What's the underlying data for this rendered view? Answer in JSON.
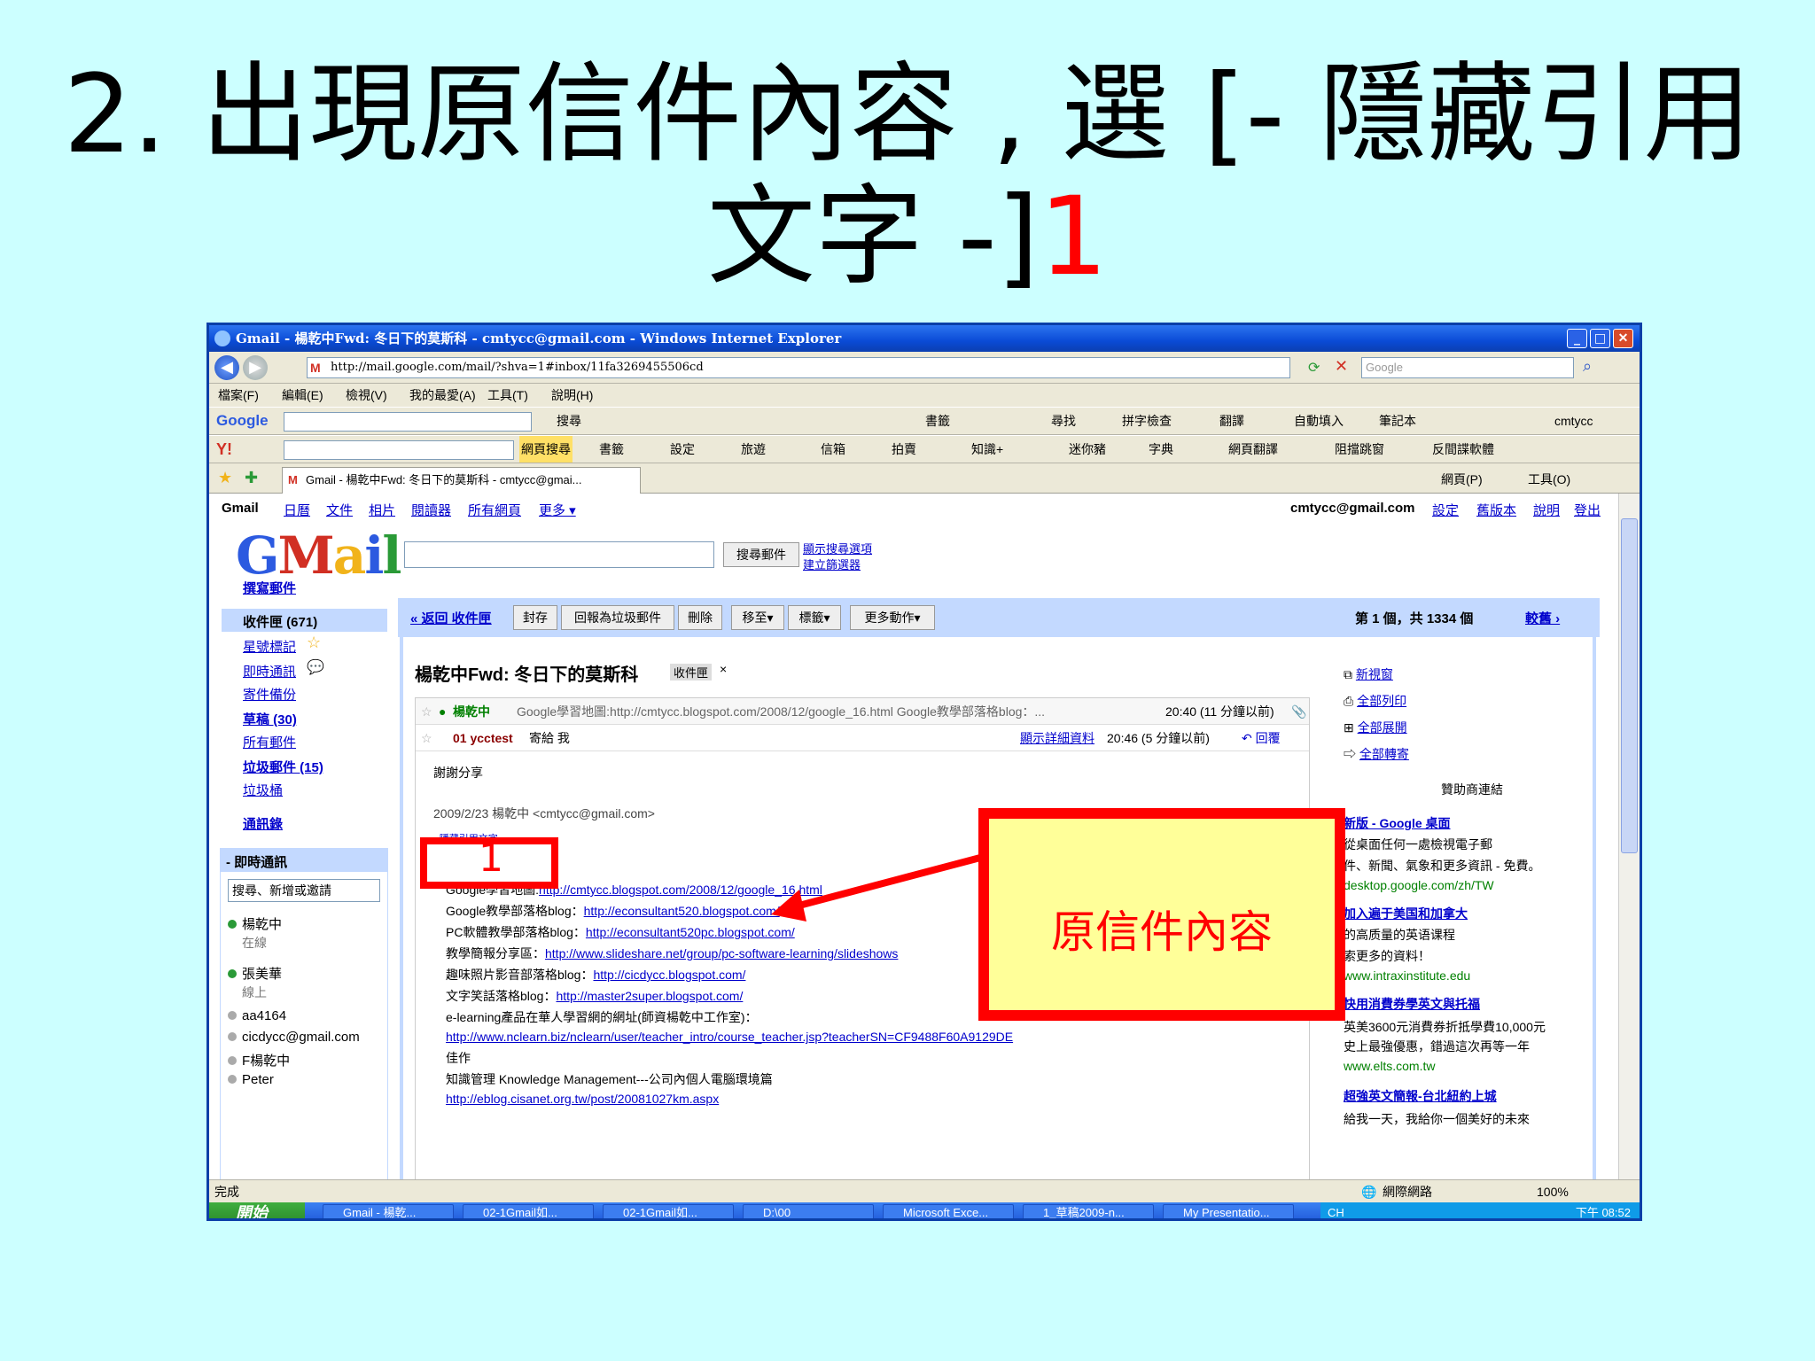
{
  "slide": {
    "title_line1": "2. 出現原信件內容 , 選 [-  隱藏引用",
    "title_line2_black": "文字  -]",
    "title_line2_red": "1",
    "callout_text": "原信件內容",
    "mark_number": "1"
  },
  "browser": {
    "window_title": "Gmail - 楊乾中Fwd: 冬日下的莫斯科 - cmtycc@gmail.com - Windows Internet Explorer",
    "address": "http://mail.google.com/mail/?shva=1#inbox/11fa3269455506cd",
    "search_placeholder": "Google",
    "menu": [
      "檔案(F)",
      "編輯(E)",
      "檢視(V)",
      "我的最愛(A)",
      "工具(T)",
      "說明(H)"
    ],
    "google_toolbar": [
      "Google",
      "搜尋",
      "書籤",
      "尋找",
      "拼字檢查",
      "翻譯",
      "自動填入",
      "筆記本",
      "cmtycc"
    ],
    "yahoo_toolbar": [
      "網頁搜尋",
      "書籤",
      "設定",
      "旅遊",
      "信箱",
      "拍賣",
      "知識+",
      "迷你豬",
      "字典",
      "網頁翻譯",
      "阻擋跳窗",
      "反間諜軟體"
    ],
    "tab_title": "Gmail - 楊乾中Fwd: 冬日下的莫斯科 - cmtycc@gmai...",
    "tab_tools": [
      "網頁(P)",
      "工具(O)"
    ],
    "status": "完成",
    "status_zone": "網際網路",
    "zoom": "100%"
  },
  "gmail": {
    "topnav": [
      "Gmail",
      "日曆",
      "文件",
      "相片",
      "閱讀器",
      "所有網頁",
      "更多 ▾"
    ],
    "account": "cmtycc@gmail.com",
    "account_links": [
      "設定",
      "舊版本",
      "說明",
      "登出"
    ],
    "search_button": "搜尋郵件",
    "search_options": [
      "顯示搜尋選項",
      "建立篩選器"
    ],
    "compose": "撰寫郵件",
    "nav": [
      {
        "label": "收件匣 (671)"
      },
      {
        "label": "星號標記"
      },
      {
        "label": "即時通訊"
      },
      {
        "label": "寄件備份"
      },
      {
        "label": "草稿 (30)"
      },
      {
        "label": "所有郵件"
      },
      {
        "label": "垃圾郵件 (15)"
      },
      {
        "label": "垃圾桶"
      },
      {
        "label": "通訊錄"
      }
    ],
    "chat": {
      "header": "- 即時通訊",
      "search": "搜尋、新增或邀請",
      "contacts": [
        {
          "name": "楊乾中",
          "status": "在線"
        },
        {
          "name": "張美華",
          "status": "線上"
        },
        {
          "name": "aa4164",
          "status": ""
        },
        {
          "name": "cicdycc@gmail.com",
          "status": ""
        },
        {
          "name": "F楊乾中",
          "status": ""
        },
        {
          "name": "Peter",
          "status": ""
        }
      ]
    },
    "actions": {
      "back": "« 返回 收件匣",
      "buttons": [
        "封存",
        "回報為垃圾郵件",
        "刪除",
        "移至▾",
        "標籤▾",
        "更多動作▾"
      ],
      "counter": "第 1 個，共 1334 個",
      "older": "較舊 ›"
    },
    "subject": "楊乾中Fwd: 冬日下的莫斯科",
    "label_chip": "收件匣",
    "messages": [
      {
        "sender": "楊乾中",
        "snippet": "Google學習地圖:http://cmtycc.blogspot.com/2008/12/google_16.html Google教學部落格blog：...",
        "time": "20:40 (11 分鐘以前)"
      },
      {
        "sender": "01 ycctest",
        "to": "寄給 我",
        "details": "顯示詳細資料",
        "time": "20:46 (5 分鐘以前)",
        "reply": "回覆"
      }
    ],
    "body_thanks": "謝謝分享",
    "quoted_from": "2009/2/23 楊乾中 <cmtycc@gmail.com>",
    "hide_quote": "- 隱藏引用文字 -",
    "body_lines": [
      {
        "label": "Google學習地圖:",
        "url": "http://cmtycc.blogspot.com/2008/12/google_16.html"
      },
      {
        "label": "Google教學部落格blog：",
        "url": "http://econsultant520.blogspot.com/"
      },
      {
        "label": "PC軟體教學部落格blog：",
        "url": "http://econsultant520pc.blogspot.com/"
      },
      {
        "label": "教學簡報分享區：",
        "url": "http://www.slideshare.net/group/pc-software-learning/slideshows"
      },
      {
        "label": "趣味照片影音部落格blog：",
        "url": "http://cicdycc.blogspot.com/"
      },
      {
        "label": "文字笑話落格blog：",
        "url": "http://master2super.blogspot.com/"
      },
      {
        "label": "e-learning產品在華人學習網的網址(師資楊乾中工作室)：",
        "url": ""
      },
      {
        "label": "",
        "url": "http://www.nclearn.biz/nclearn/user/teacher_intro/course_teacher.jsp?teacherSN=CF9488F60A9129DE"
      },
      {
        "label": "佳作",
        "url": ""
      },
      {
        "label": "知識管理 Knowledge Management---公司內個人電腦環境篇",
        "url": ""
      },
      {
        "label": "",
        "url": "http://eblog.cisanet.org.tw/post/20081027km.aspx"
      }
    ],
    "side_actions": [
      "新視窗",
      "全部列印",
      "全部展開",
      "全部轉寄"
    ],
    "sponsor_head": "贊助商連結",
    "ads": [
      {
        "title": "新版 - Google 桌面",
        "line1": "從桌面任何一處檢視電子郵",
        "line2": "件、新聞、氣象和更多資訊 - 免費。",
        "url": "desktop.google.com/zh/TW"
      },
      {
        "title": "加入遍于美国和加拿大",
        "line1": "的高质量的英语课程",
        "line2": "索更多的資料！",
        "url": "www.intraxinstitute.edu"
      },
      {
        "title": "快用消費券學英文與托福",
        "line1": "英美3600元消費券折抵學費10,000元",
        "line2": "史上最強優惠，錯過這次再等一年",
        "url": "www.elts.com.tw"
      },
      {
        "title": "超強英文簡報-台北紐約上城",
        "line1": "給我一天，我給你一個美好的未來",
        "line2": "",
        "url": ""
      }
    ]
  },
  "taskbar": {
    "start": "開始",
    "tasks": [
      "Gmail - 楊乾...",
      "02-1Gmail如...",
      "02-1Gmail如...",
      "D:\\00",
      "Microsoft Exce...",
      "1_草稿2009-n...",
      "My Presentatio..."
    ],
    "clock": "下午 08:52",
    "lang": "CH"
  },
  "colors": {
    "slide_bg": "#ccffff",
    "accent_red": "#ff0000",
    "callout_fill": "#ffff99",
    "gmail_blue": "#c3d9ff"
  }
}
